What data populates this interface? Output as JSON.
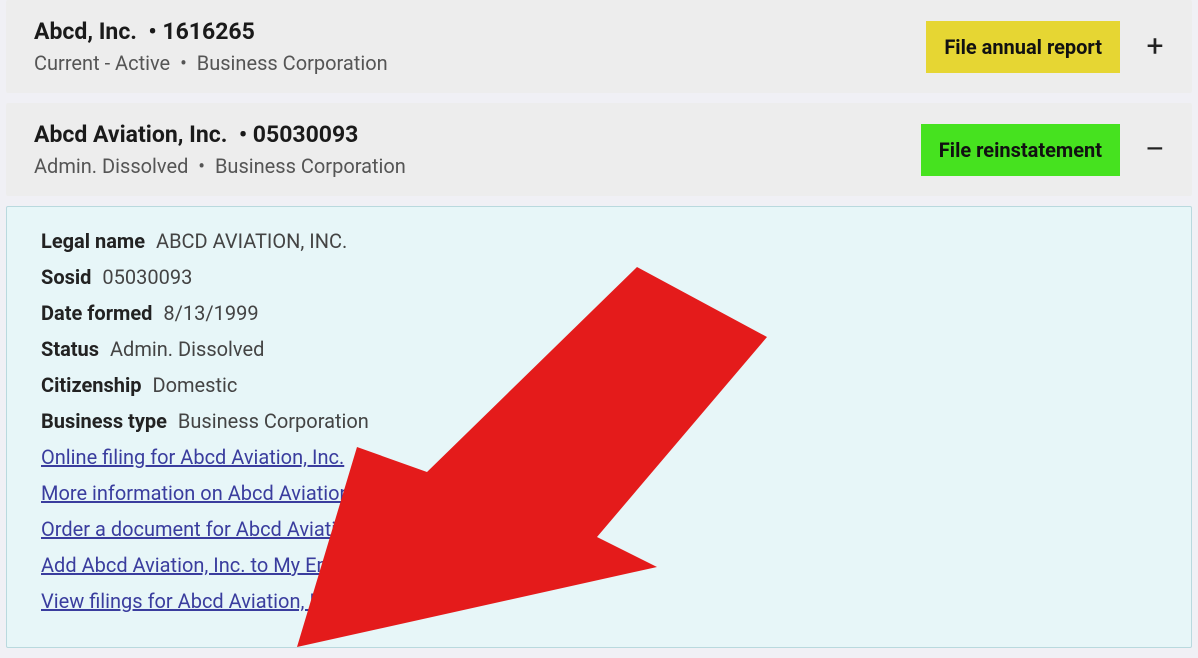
{
  "entries": [
    {
      "name": "Abcd, Inc.",
      "id": "1616265",
      "status_line": "Current - Active",
      "type": "Business Corporation",
      "action_label": "File annual report",
      "action_color": "yellow",
      "expanded": false
    },
    {
      "name": "Abcd Aviation, Inc.",
      "id": "05030093",
      "status_line": "Admin. Dissolved",
      "type": "Business Corporation",
      "action_label": "File reinstatement",
      "action_color": "green",
      "expanded": true
    }
  ],
  "details": {
    "fields": {
      "legal_name_label": "Legal name",
      "legal_name_value": "ABCD AVIATION, INC.",
      "sosid_label": "Sosid",
      "sosid_value": "05030093",
      "date_formed_label": "Date formed",
      "date_formed_value": "8/13/1999",
      "status_label": "Status",
      "status_value": "Admin. Dissolved",
      "citizenship_label": "Citizenship",
      "citizenship_value": "Domestic",
      "business_type_label": "Business type",
      "business_type_value": "Business Corporation"
    },
    "links": {
      "online_filing": "Online filing for Abcd Aviation, Inc.",
      "more_info": "More information on Abcd Aviation, Inc.",
      "order_doc": "Order a document for Abcd Aviation, Inc.",
      "add_notification": "Add Abcd Aviation, Inc. to My Email Notification list",
      "view_filings": "View filings for Abcd Aviation, Inc."
    }
  },
  "bullet": "•",
  "plus": "+",
  "minus": "–",
  "arrow_color": "#e41b1b"
}
